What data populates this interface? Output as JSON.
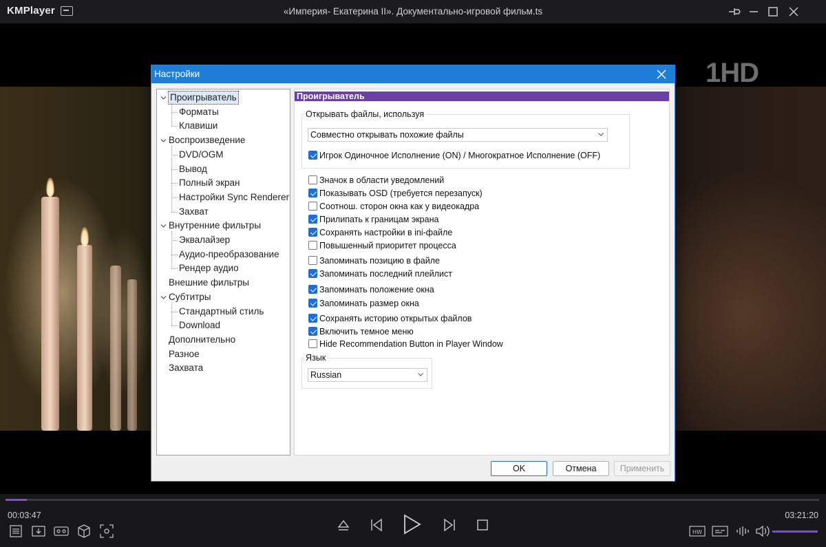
{
  "app": {
    "logo": "KMPlayer",
    "window_title": "«Империя- Екатерина II». Документально-игровой фильм.ts"
  },
  "video": {
    "channel_logo": "1HD"
  },
  "dialog": {
    "title": "Настройки",
    "tree": [
      {
        "label": "Проигрыватель",
        "level": 0,
        "expanded": true,
        "selected": true
      },
      {
        "label": "Форматы",
        "level": 1
      },
      {
        "label": "Клавиши",
        "level": 1
      },
      {
        "label": "Воспроизведение",
        "level": 0,
        "expanded": true
      },
      {
        "label": "DVD/OGM",
        "level": 1
      },
      {
        "label": "Вывод",
        "level": 1
      },
      {
        "label": "Полный экран",
        "level": 1
      },
      {
        "label": "Настройки Sync Renderer",
        "level": 1
      },
      {
        "label": "Захват",
        "level": 1
      },
      {
        "label": "Внутренние фильтры",
        "level": 0,
        "expanded": true
      },
      {
        "label": "Эквалайзер",
        "level": 1
      },
      {
        "label": "Аудио-преобразование",
        "level": 1
      },
      {
        "label": "Рендер аудио",
        "level": 1
      },
      {
        "label": "Внешние фильтры",
        "level": 0
      },
      {
        "label": "Субтитры",
        "level": 0,
        "expanded": true
      },
      {
        "label": "Стандартный стиль",
        "level": 1
      },
      {
        "label": "Download",
        "level": 1
      },
      {
        "label": "Дополнительно",
        "level": 0
      },
      {
        "label": "Разное",
        "level": 0
      },
      {
        "label": "Захвата",
        "level": 0
      }
    ],
    "section_header": "Проигрыватель",
    "open_files_group": {
      "label": "Открывать файлы, используя",
      "select_value": "Совместно открывать похожие файлы",
      "single_instance_checkbox": {
        "label": "Игрок Одиночное Исполнение (ON) / Многократное Исполнение (OFF)",
        "checked": true
      }
    },
    "checkboxes": [
      {
        "label": "Значок в области уведомлений",
        "checked": false
      },
      {
        "label": "Показывать OSD (требуется перезапуск)",
        "checked": true
      },
      {
        "label": "Соотнош. сторон окна как у видеокадра",
        "checked": false
      },
      {
        "label": "Прилипать к границам экрана",
        "checked": true
      },
      {
        "label": "Сохранять настройки в ini-файле",
        "checked": true
      },
      {
        "label": "Повышенный приоритет процесса",
        "checked": false
      },
      {
        "label": "Запоминать позицию в файле",
        "checked": false
      },
      {
        "label": "Запоминать последний плейлист",
        "checked": true
      },
      {
        "label": "Запоминать положение окна",
        "checked": true
      },
      {
        "label": "Запоминать размер окна",
        "checked": true
      },
      {
        "label": "Сохранять историю открытых файлов",
        "checked": true
      },
      {
        "label": "Включить темное меню",
        "checked": true
      },
      {
        "label": "Hide Recommendation Button in Player Window",
        "checked": false
      }
    ],
    "language_group": {
      "label": "Язык",
      "select_value": "Russian"
    },
    "buttons": {
      "ok": "OK",
      "cancel": "Отмена",
      "apply": "Применить"
    }
  },
  "playback": {
    "elapsed": "00:03:47",
    "duration": "03:21:20",
    "progress_fraction": 0.026,
    "volume_fraction": 1.0
  },
  "colors": {
    "accent": "#7b4de0",
    "dialog_title_bar": "#1f7fd8",
    "section_header": "#6b3fa8",
    "checkbox_checked": "#1f6fd0"
  }
}
